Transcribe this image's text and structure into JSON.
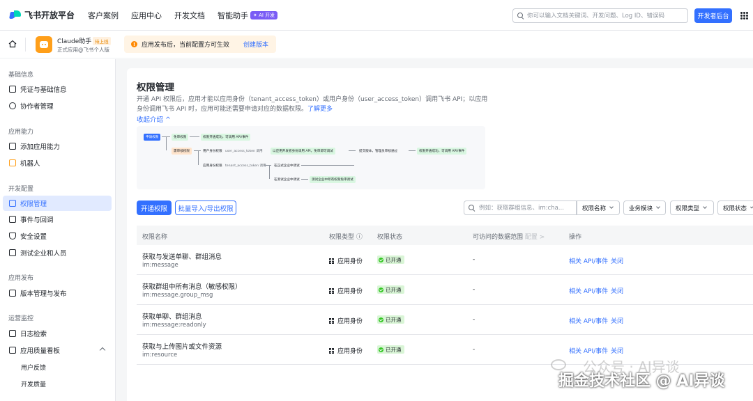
{
  "topnav": {
    "logo": "飞书开放平台",
    "links": [
      "客户案例",
      "应用中心",
      "开发文档",
      "智能助手"
    ],
    "ai_badge": "✦ AI 开发",
    "search_placeholder": "你可以输入文档关键词、开发问题、Log ID、错误码",
    "dev_console": "开发者后台"
  },
  "appbar": {
    "app_name": "Claude助手",
    "app_status": "待上线",
    "app_sub": "正式应用@飞书个人版",
    "notice": "应用发布后，当前配置方可生效",
    "notice_icon": "!",
    "notice_link": "创建版本"
  },
  "sidebar": {
    "groups": [
      "基础信息",
      "应用能力",
      "开发配置",
      "应用发布",
      "运营监控"
    ],
    "items": [
      "凭证与基础信息",
      "协作者管理",
      "添加应用能力",
      "机器人",
      "权限管理",
      "事件与回调",
      "安全设置",
      "测试企业和人员",
      "版本管理与发布",
      "日志检索",
      "应用质量看板"
    ],
    "subitems": [
      "用户反馈",
      "开发质量"
    ]
  },
  "main": {
    "title": "权限管理",
    "desc": "开通 API 权限后，应用才能以应用身份（tenant_access_token）或用户身份（user_access_token）调用飞书 API；以应用身份调用飞书 API 时，应用可能还需要申请对应的数据权限。",
    "learn_more": "了解更多",
    "collapse": "收起介绍 ^",
    "flow": {
      "apply": "申请权限",
      "exempt": "免审权限",
      "exempt_result": "权限开通成功，可调用 API/事件",
      "review": "需审核权限",
      "user_perm": "用户身份权限",
      "user_token": "user_access_token 调用",
      "test_identity": "以应用开发者身份调用 API，免审即可调试",
      "submit": "提交版本，管理员审核通过",
      "review_result": "权限开通成功，可调用 API/事件",
      "app_perm": "应用身份权限",
      "tenant_token": "tenant_access_token 调用",
      "in_prod": "在正式企业中调试",
      "in_test": "在测试企业中调试",
      "test_result": "测试企业中所有权限免审调试"
    },
    "btn_enable": "开通权限",
    "btn_batch": "批量导入/导出权限",
    "filter_placeholder": "例如：获取群组信息、im:cha...",
    "filters": [
      "权限名称",
      "业务模块",
      "权限类型",
      "权限状态"
    ],
    "columns": [
      "权限名称",
      "权限类型 ⓘ",
      "权限状态",
      "可访问的数据范围",
      "配置 >",
      "操作"
    ],
    "rows": [
      {
        "name": "获取与发送单聊、群组消息",
        "code": "im:message",
        "type": "应用身份",
        "status": "已开通",
        "scope": "-",
        "act1": "相关 API/事件",
        "act2": "关闭"
      },
      {
        "name": "获取群组中所有消息（敏感权限）",
        "code": "im:message.group_msg",
        "type": "应用身份",
        "status": "已开通",
        "scope": "-",
        "act1": "相关 API/事件",
        "act2": "关闭"
      },
      {
        "name": "获取单聊、群组消息",
        "code": "im:message:readonly",
        "type": "应用身份",
        "status": "已开通",
        "scope": "-",
        "act1": "相关 API/事件",
        "act2": "关闭"
      },
      {
        "name": "获取与上传图片或文件资源",
        "code": "im:resource",
        "type": "应用身份",
        "status": "已开通",
        "scope": "-",
        "act1": "相关 API/事件",
        "act2": "关闭"
      }
    ]
  },
  "watermark": {
    "line1": "公众号 · AI异谈",
    "line2": "掘金技术社区 @ AI异谈"
  }
}
